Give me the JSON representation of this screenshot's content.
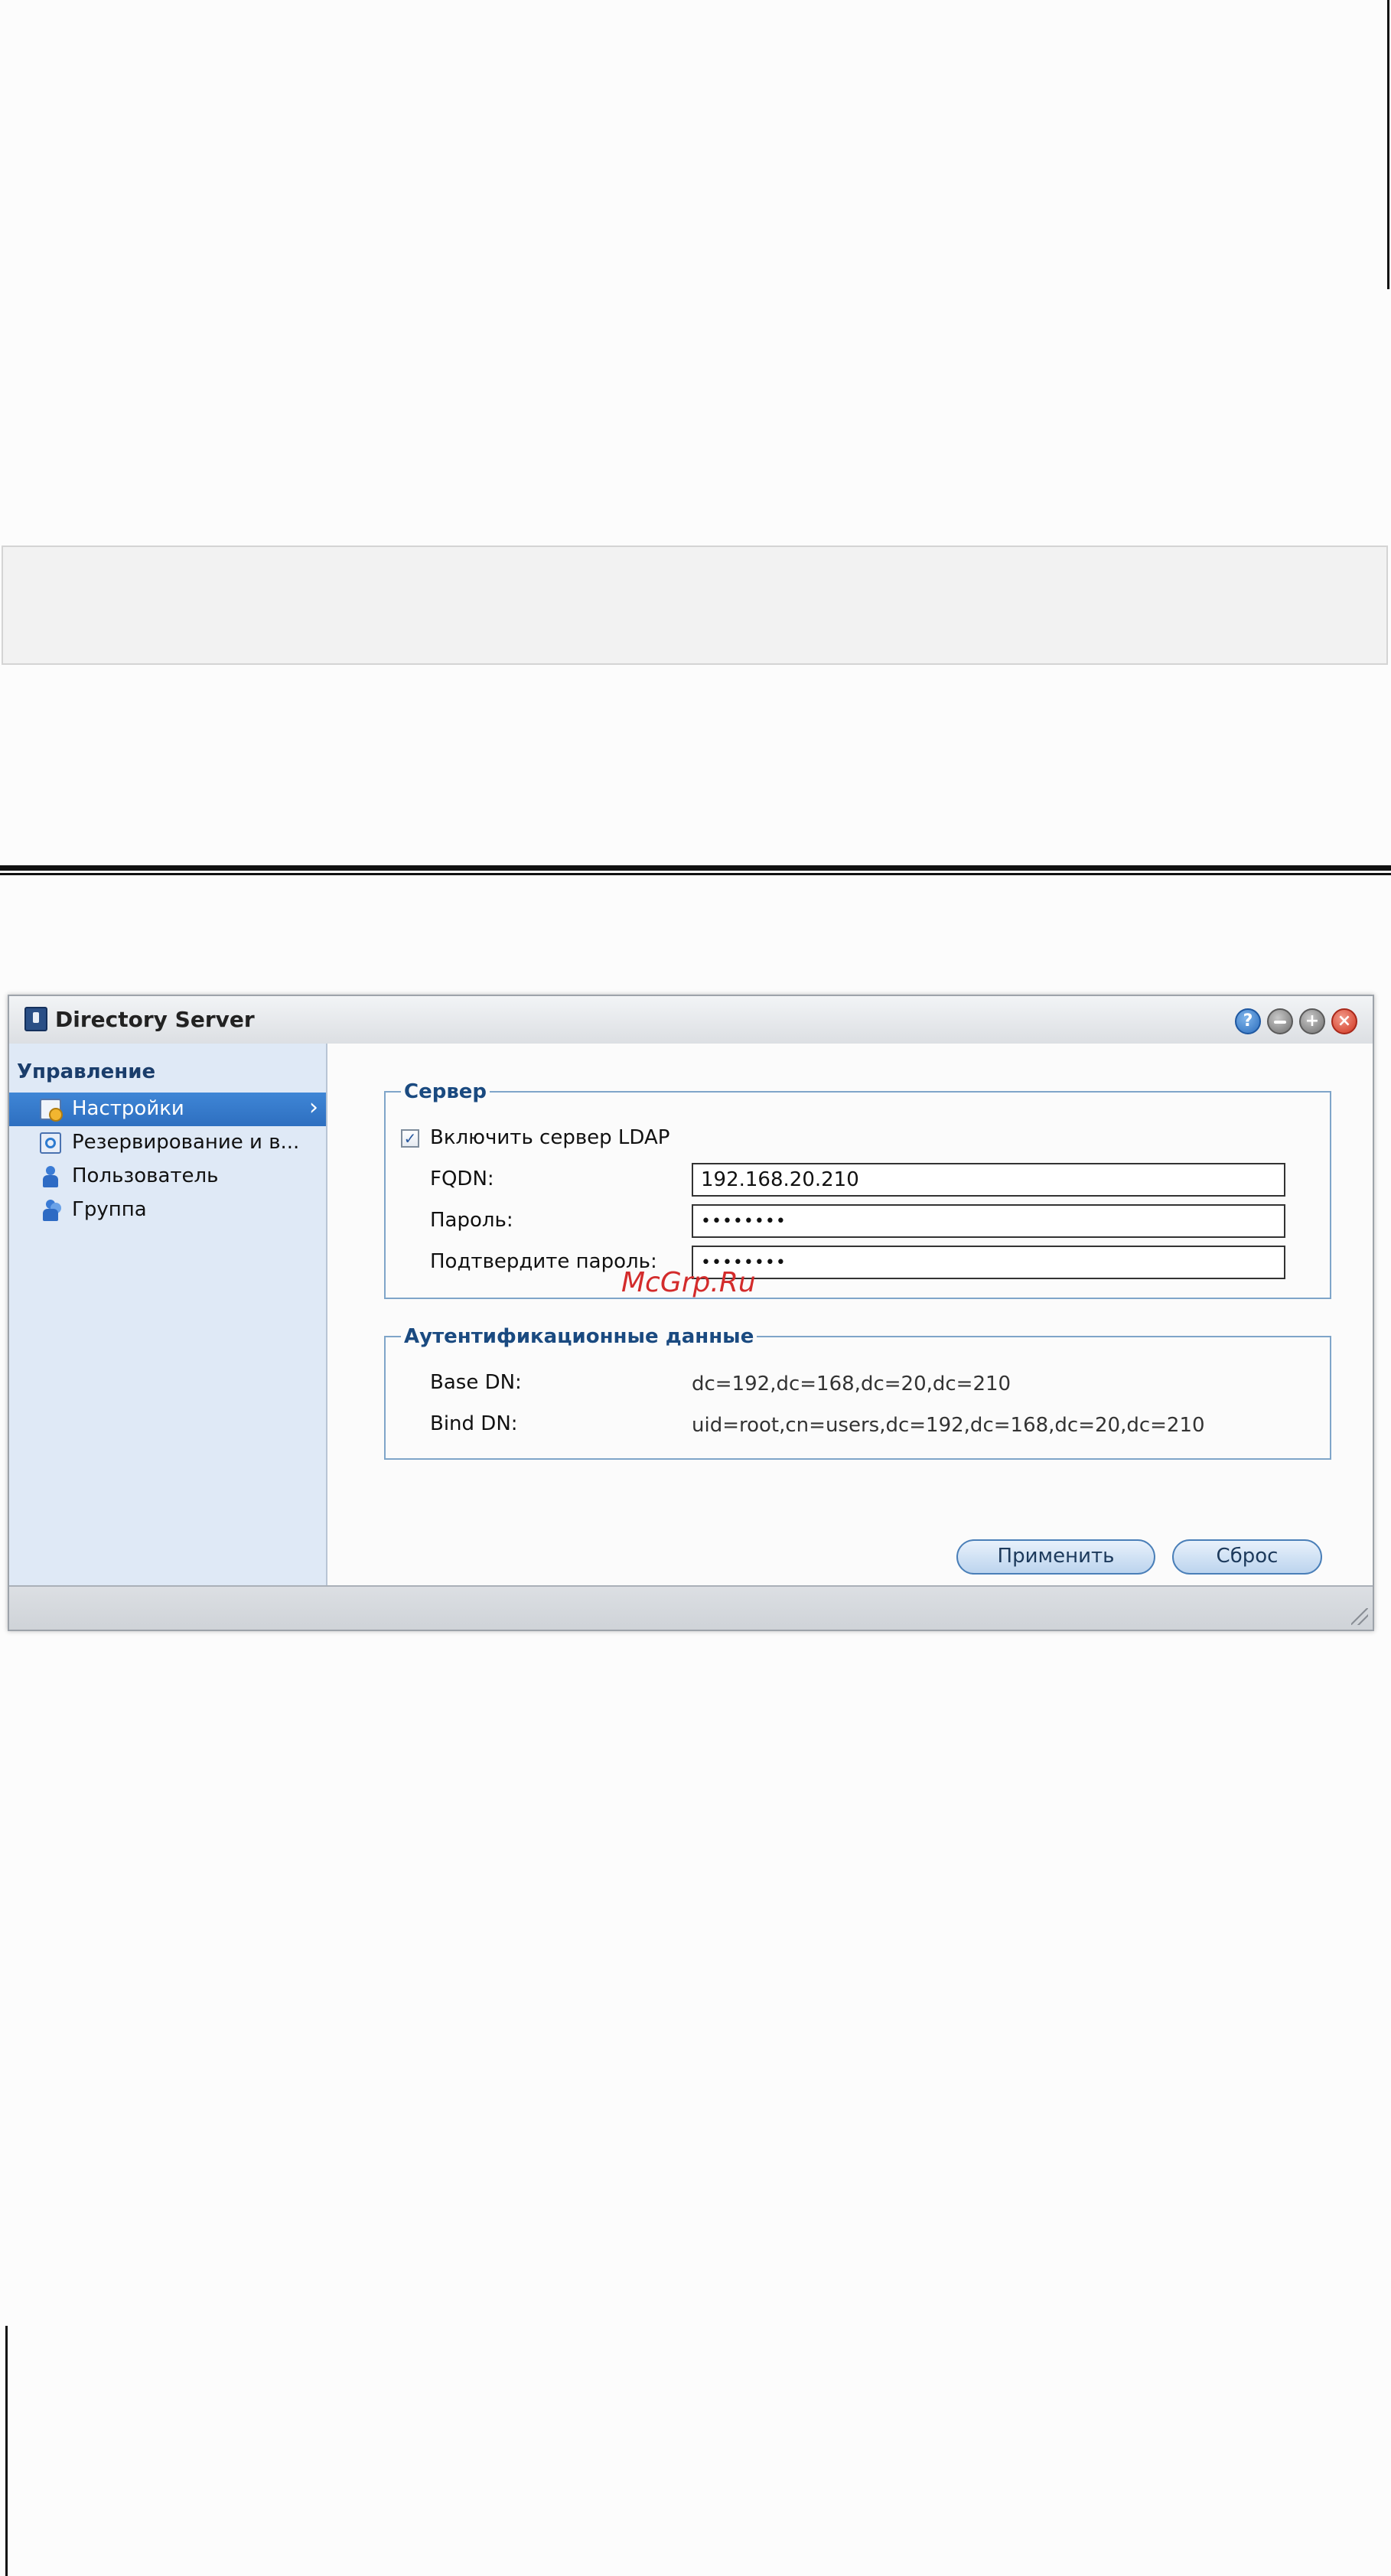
{
  "window": {
    "title": "Directory Server"
  },
  "sidebar": {
    "header": "Управление",
    "items": [
      {
        "label": "Настройки",
        "icon": "settings-icon",
        "selected": true
      },
      {
        "label": "Резервирование и в...",
        "icon": "backup-icon",
        "selected": false
      },
      {
        "label": "Пользователь",
        "icon": "user-icon",
        "selected": false
      },
      {
        "label": "Группа",
        "icon": "group-icon",
        "selected": false
      }
    ],
    "chevron": "›"
  },
  "server": {
    "legend": "Сервер",
    "enable_ldap_label": "Включить сервер LDAP",
    "enable_ldap_checked": true,
    "fqdn_label": "FQDN:",
    "fqdn_value": "192.168.20.210",
    "password_label": "Пароль:",
    "password_value": "••••••••",
    "confirm_password_label": "Подтвердите пароль:",
    "confirm_password_value": "••••••••"
  },
  "auth": {
    "legend": "Аутентификационные данные",
    "base_dn_label": "Base DN:",
    "base_dn_value": "dc=192,dc=168,dc=20,dc=210",
    "bind_dn_label": "Bind DN:",
    "bind_dn_value": "uid=root,cn=users,dc=192,dc=168,dc=20,dc=210"
  },
  "buttons": {
    "apply": "Применить",
    "reset": "Сброс"
  },
  "title_buttons": {
    "help": "?",
    "maximize": "+",
    "close": "×"
  },
  "watermark": "McGrp.Ru",
  "colors": {
    "accent": "#2e6fc0",
    "sidebar_bg": "#dfe9f6",
    "legend": "#1a4a80",
    "watermark": "#d32b2b"
  }
}
